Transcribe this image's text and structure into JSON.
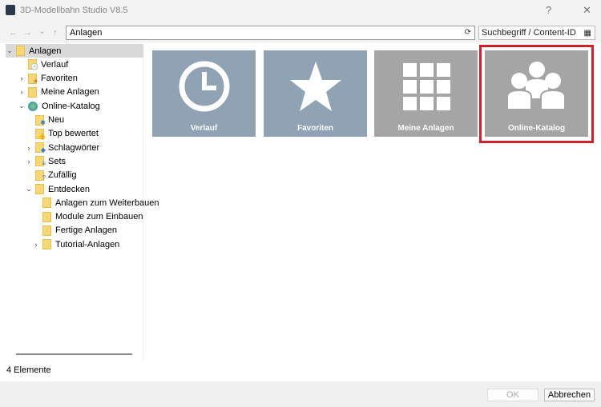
{
  "window": {
    "title": "3D-Modellbahn Studio V8.5",
    "help": "?",
    "close": "✕"
  },
  "toolbar": {
    "back": "←",
    "forward": "→",
    "dropdown": "⌄",
    "up": "↑",
    "address": "Anlagen",
    "refresh": "⟳",
    "search_placeholder": "Suchbegriff / Content-ID",
    "view_toggle": "▦"
  },
  "tree": [
    {
      "label": "Anlagen",
      "level": 0,
      "exp": "⌄",
      "badge": ""
    },
    {
      "label": "Verlauf",
      "level": 1,
      "exp": "",
      "badge": "🕓"
    },
    {
      "label": "Favoriten",
      "level": 1,
      "exp": "›",
      "badge": "★"
    },
    {
      "label": "Meine Anlagen",
      "level": 1,
      "exp": "›",
      "badge": ""
    },
    {
      "label": "Online-Katalog",
      "level": 1,
      "exp": "⌄",
      "badge": "globe"
    },
    {
      "label": "Neu",
      "level": 2,
      "exp": "",
      "badge": "✱"
    },
    {
      "label": "Top bewertet",
      "level": 2,
      "exp": "",
      "badge": "👍"
    },
    {
      "label": "Schlagwörter",
      "level": 2,
      "exp": "›",
      "badge": "◆"
    },
    {
      "label": "Sets",
      "level": 2,
      "exp": "›",
      "badge": "≡"
    },
    {
      "label": "Zufällig",
      "level": 2,
      "exp": "",
      "badge": "?"
    },
    {
      "label": "Entdecken",
      "level": 2,
      "exp": "⌄",
      "badge": ""
    },
    {
      "label": "Anlagen zum Weiterbauen",
      "level": 3,
      "exp": "",
      "badge": ""
    },
    {
      "label": "Module zum Einbauen",
      "level": 3,
      "exp": "",
      "badge": ""
    },
    {
      "label": "Fertige Anlagen",
      "level": 3,
      "exp": "",
      "badge": ""
    },
    {
      "label": "Tutorial-Anlagen",
      "level": 3,
      "exp": "›",
      "badge": ""
    }
  ],
  "tiles": [
    {
      "label": "Verlauf",
      "icon": "clock-icon",
      "color": "#8fa3b4"
    },
    {
      "label": "Favoriten",
      "icon": "star-icon",
      "color": "#8fa3b4"
    },
    {
      "label": "Meine Anlagen",
      "icon": "grid-icon",
      "color": "#a5a5a5"
    },
    {
      "label": "Online-Katalog",
      "icon": "people-icon",
      "color": "#a5a5a5",
      "highlighted": true
    }
  ],
  "highlight_color": "#d4202a",
  "status": "4 Elemente",
  "buttons": {
    "ok": "OK",
    "cancel": "Abbrechen"
  }
}
